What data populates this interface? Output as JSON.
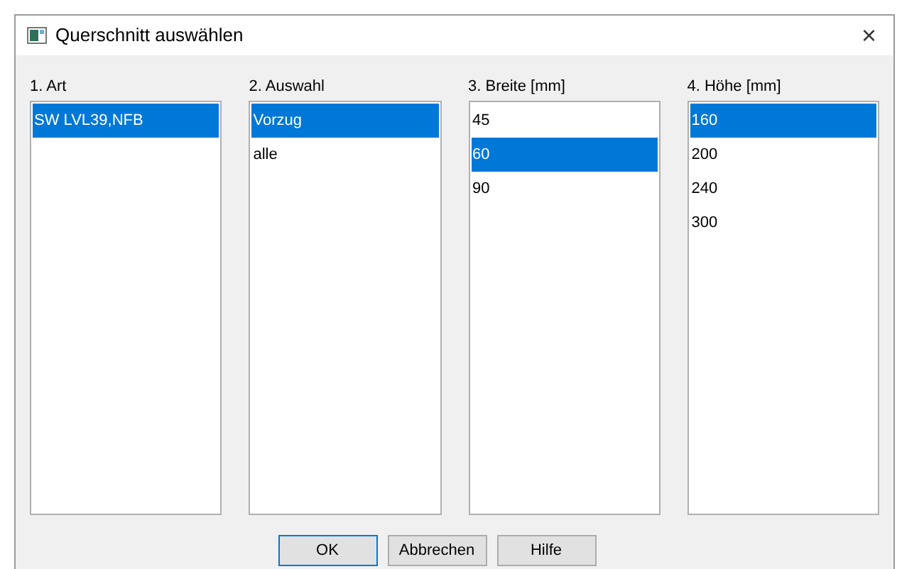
{
  "window": {
    "title": "Querschnitt auswählen",
    "close": "×"
  },
  "lists": [
    {
      "label": "1. Art",
      "items": [
        {
          "text": "SW LVL39,NFB",
          "selected": true
        }
      ]
    },
    {
      "label": "2. Auswahl",
      "items": [
        {
          "text": "Vorzug",
          "selected": true
        },
        {
          "text": "alle",
          "selected": false
        }
      ]
    },
    {
      "label": "3. Breite [mm]",
      "items": [
        {
          "text": "45",
          "selected": false
        },
        {
          "text": "60",
          "selected": true
        },
        {
          "text": "90",
          "selected": false
        }
      ]
    },
    {
      "label": "4. Höhe [mm]",
      "items": [
        {
          "text": "160",
          "selected": true
        },
        {
          "text": "200",
          "selected": false
        },
        {
          "text": "240",
          "selected": false
        },
        {
          "text": "300",
          "selected": false
        }
      ]
    }
  ],
  "buttons": [
    {
      "label": "OK",
      "default": true
    },
    {
      "label": "Abbrechen",
      "default": false
    },
    {
      "label": "Hilfe",
      "default": false
    }
  ]
}
